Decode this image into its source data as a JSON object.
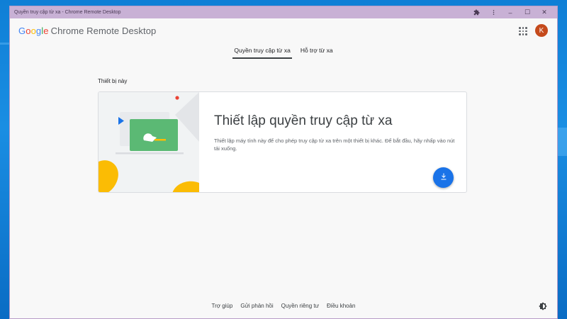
{
  "window": {
    "title": "Quyền truy cập từ xa - Chrome Remote Desktop",
    "controls": {
      "extensions_icon": "puzzle-icon",
      "menu_icon": "more-vert-icon",
      "minimize_label": "–",
      "maximize_label": "☐",
      "close_label": "✕"
    }
  },
  "header": {
    "logo_letters": [
      "G",
      "o",
      "o",
      "g",
      "l",
      "e"
    ],
    "product_name": "Chrome Remote Desktop",
    "avatar_initial": "K",
    "avatar_color": "#c54a1c"
  },
  "tabs": [
    {
      "label": "Quyền truy cập từ xa",
      "active": true
    },
    {
      "label": "Hỗ trợ từ xa",
      "active": false
    }
  ],
  "devices": {
    "section_label": "Thiết bị này",
    "card": {
      "title": "Thiết lập quyền truy cập từ xa",
      "description": "Thiết lập máy tính này để cho phép truy cập từ xa trên một thiết bị khác. Để bắt đầu, hãy nhấp vào nút tải xuống.",
      "download_icon": "download-icon",
      "accent_color": "#1a73e8"
    }
  },
  "footer": {
    "links": [
      "Trợ giúp",
      "Gửi phản hồi",
      "Quyền riêng tư",
      "Điều khoản"
    ],
    "theme_icon": "brightness-icon"
  }
}
